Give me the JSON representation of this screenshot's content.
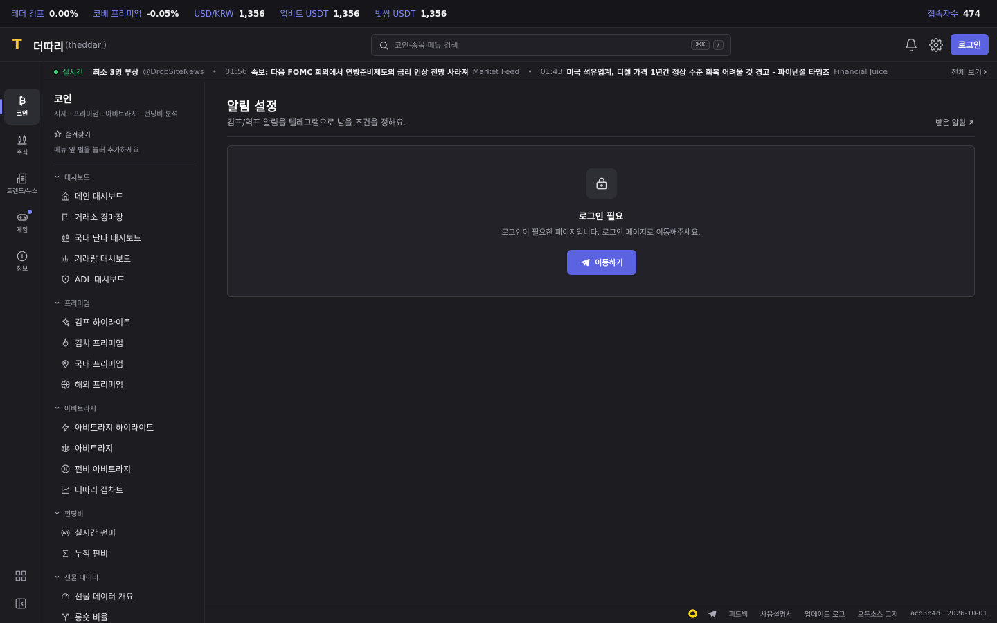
{
  "ticker": [
    {
      "label": "테더 김프",
      "value": "0.00%"
    },
    {
      "label": "코베 프리미엄",
      "value": "-0.05%"
    },
    {
      "label": "USD/KRW",
      "value": "1,356"
    },
    {
      "label": "업비트 USDT",
      "value": "1,356"
    },
    {
      "label": "빗썸 USDT",
      "value": "1,356"
    }
  ],
  "users": {
    "label": "접속자수",
    "value": "474"
  },
  "header": {
    "logo": "T",
    "brand": "더따리",
    "brand_sub": "(theddari)",
    "search_placeholder": "코인·종목·메뉴 검색",
    "kbd1": "⌘K",
    "kbd2": "/",
    "login": "로그인"
  },
  "news": {
    "live": "실시간",
    "items": [
      {
        "time": "",
        "headline": "최소 3명 부상",
        "source": "@DropSiteNews"
      },
      {
        "time": "01:56",
        "headline": "속보: 다음 FOMC 회의에서 연방준비제도의 금리 인상 전망 사라져",
        "source": "Market Feed"
      },
      {
        "time": "01:43",
        "headline": "미국 석유업계, 디젤 가격 1년간 정상 수준 회복 어려울 것 경고 - 파이낸셜 타임즈",
        "source": "Financial Juice"
      }
    ],
    "all": "전체 보기"
  },
  "rail": {
    "coin": "코인",
    "stock": "주식",
    "trend": "트렌드/뉴스",
    "game": "게임",
    "info": "정보"
  },
  "sidebar": {
    "title": "코인",
    "subtitle": "시세 · 프리미엄 · 아비트라지 · 펀딩비 분석",
    "favorites": "즐겨찾기",
    "favorites_hint": "메뉴 옆 별을 눌러 추가하세요",
    "groups": {
      "dashboard": {
        "label": "대시보드",
        "items": [
          "메인 대시보드",
          "거래소 경마장",
          "국내 단타 대시보드",
          "거래량 대시보드",
          "ADL 대시보드"
        ]
      },
      "premium": {
        "label": "프리미엄",
        "items": [
          "김프 하이라이트",
          "김치 프리미엄",
          "국내 프리미엄",
          "해외 프리미엄"
        ]
      },
      "arbitrage": {
        "label": "아비트라지",
        "items": [
          "아비트라지 하이라이트",
          "아비트라지",
          "펀비 아비트라지",
          "더따리 갭차트"
        ]
      },
      "funding": {
        "label": "펀딩비",
        "items": [
          "실시간 펀비",
          "누적 펀비"
        ]
      },
      "futures": {
        "label": "선물 데이터",
        "items": [
          "선물 데이터 개요",
          "롱숏 비율"
        ]
      }
    }
  },
  "main": {
    "title": "알림 설정",
    "subtitle": "김프/역프 알림을 텔레그램으로 받을 조건을 정해요.",
    "received": "받은 알림",
    "card": {
      "title": "로그인 필요",
      "desc": "로그인이 필요한 페이지입니다. 로그인 페이지로 이동해주세요.",
      "button": "이동하기"
    }
  },
  "footer": {
    "feedback": "피드백",
    "manual": "사용설명서",
    "changelog": "업데이트 로그",
    "oss": "오픈소스 고지",
    "version": "acd3b4d · 2026-10-01"
  },
  "colors": {
    "accent": "#5b63e0",
    "live": "#36c46d",
    "logo": "#f3c33c"
  }
}
